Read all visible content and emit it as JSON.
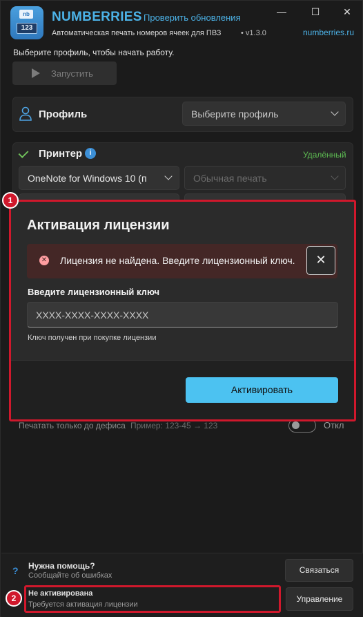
{
  "app": {
    "name": "NUMBERRIES",
    "update_link": "Проверить обновления",
    "subtitle": "Автоматическая печать номеров ячеек для ПВЗ",
    "version": "• v1.3.0",
    "site_link": "numberries.ru",
    "logo_top": "nb",
    "logo_bottom": "123"
  },
  "window_controls": {
    "minimize": "—",
    "maximize": "☐",
    "close": "✕"
  },
  "main": {
    "hint": "Выберите профиль, чтобы начать работу.",
    "run_label": "Запустить",
    "profile_label": "Профиль",
    "profile_placeholder": "Выберите профиль",
    "printer_label": "Принтер",
    "printer_status": "Удалённый",
    "printer_value": "OneNote for Windows 10 (п",
    "print_mode": "Обычная печать",
    "dash_label": "Печатать только до дефиса",
    "dash_example": "Пример: 123-45 → 123",
    "toggle_label": "Откл"
  },
  "modal": {
    "title": "Активация лицензии",
    "error_text": "Лицензия не найдена. Введите лицензионный ключ.",
    "key_label": "Введите лицензионный ключ",
    "key_placeholder": "XXXX-XXXX-XXXX-XXXX",
    "key_help": "Ключ получен при покупке лицензии",
    "activate_label": "Активировать"
  },
  "footer": {
    "help_title": "Нужна помощь?",
    "help_sub": "Сообщайте об ошибках",
    "contact_label": "Связаться",
    "status_title": "Не активирована",
    "status_sub": "Требуется активация лицензии",
    "manage_label": "Управление"
  },
  "markers": [
    "1",
    "2"
  ],
  "colors": {
    "accent": "#4cb3e8",
    "button": "#4cc2f1",
    "highlight": "#d0182c",
    "ok": "#5dbb52"
  }
}
